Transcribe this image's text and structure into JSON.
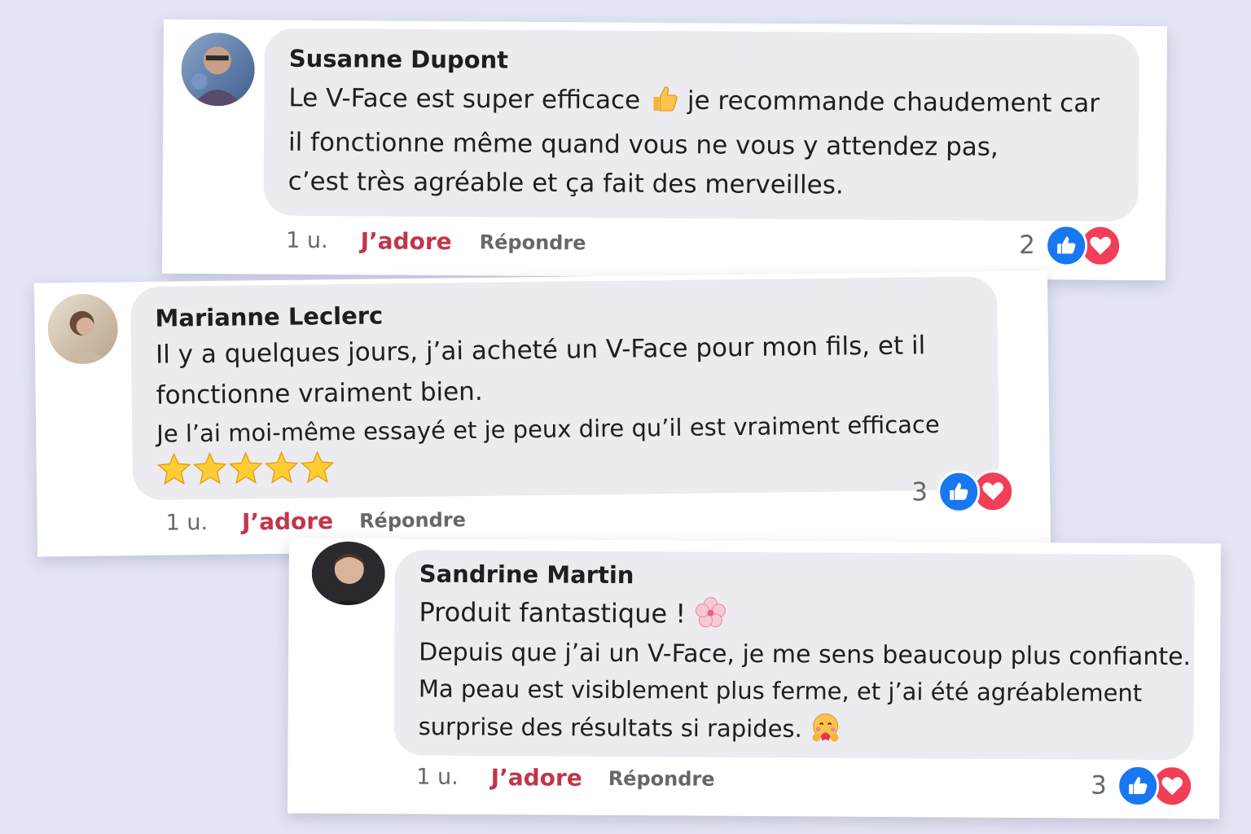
{
  "comments": [
    {
      "author": "Susanne Dupont",
      "lines": [
        "Le V-Face est super efficace",
        "je recommande chaudement car",
        "il fonctionne même quand vous ne vous y attendez pas,",
        "c’est très agréable et ça fait des merveilles."
      ],
      "time": "1 u.",
      "love_label": "J’adore",
      "reply_label": "Répondre",
      "reaction_count": "2",
      "icons": [
        "avatar",
        "thumbs-up-emoji",
        "like-icon",
        "heart-icon"
      ]
    },
    {
      "author": "Marianne Leclerc",
      "lines": [
        "Il y a quelques jours, j’ai acheté un V-Face pour mon fils, et il",
        "fonctionne vraiment bien.",
        "Je l’ai moi-même essayé et je peux dire qu’il est vraiment efficace"
      ],
      "rating": 5,
      "time": "1 u.",
      "love_label": "J’adore",
      "reply_label": "Répondre",
      "reaction_count": "3",
      "icons": [
        "avatar",
        "star-icon",
        "like-icon",
        "heart-icon"
      ]
    },
    {
      "author": "Sandrine Martin",
      "lines": [
        "Produit fantastique !",
        "Depuis que j’ai un V-Face, je me sens beaucoup plus confiante.",
        "Ma peau est visiblement plus ferme, et j’ai été agréablement",
        "surprise des résultats si rapides."
      ],
      "time": "1 u.",
      "love_label": "J’adore",
      "reply_label": "Répondre",
      "reaction_count": "3",
      "icons": [
        "avatar",
        "cherry-blossom-emoji",
        "hugging-face-emoji",
        "like-icon",
        "heart-icon"
      ]
    }
  ],
  "colors": {
    "background": "#e3e5f5",
    "card": "#ffffff",
    "bubble": "#ebebf0",
    "love": "#c1364a",
    "like": "#1877f2",
    "heart": "#f33e58",
    "meta": "#65676b"
  }
}
